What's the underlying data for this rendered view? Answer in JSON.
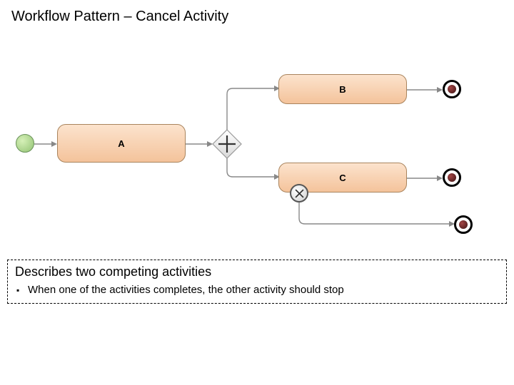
{
  "title": "Workflow Pattern – Cancel Activity",
  "description": {
    "heading": "Describes two competing activities",
    "bullet1": "When one of the activities completes, the other activity should stop"
  },
  "tasks": {
    "a": "A",
    "b": "B",
    "c": "C"
  }
}
